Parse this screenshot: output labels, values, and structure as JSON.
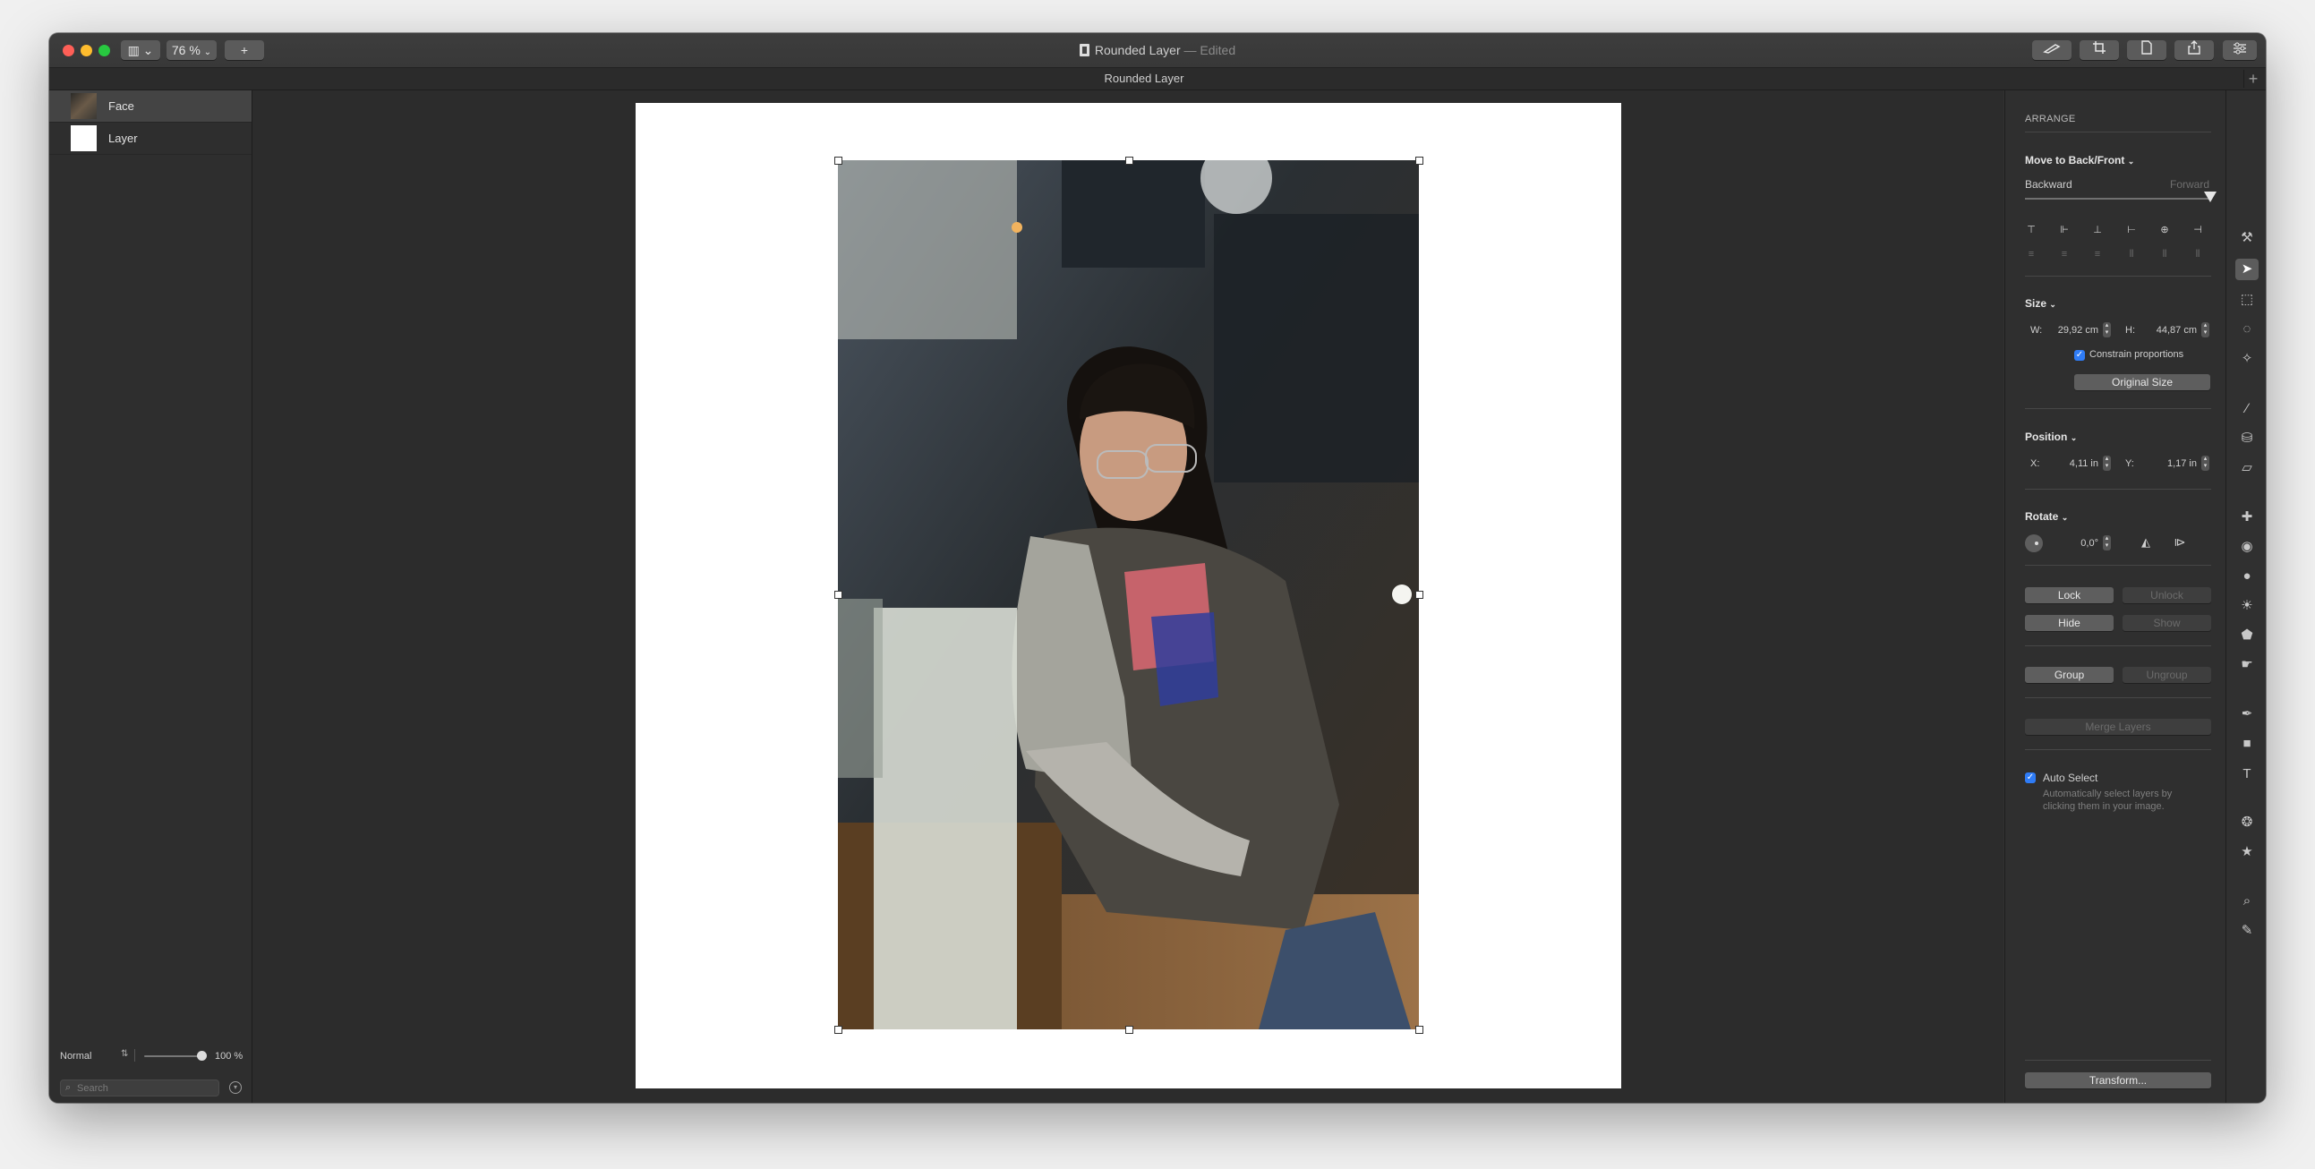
{
  "window": {
    "title": "Rounded Layer",
    "edited": "— Edited",
    "zoom": "76 %",
    "tab_title": "Rounded Layer",
    "add_tab": "+"
  },
  "toolbar": {
    "sidebar_btn": "▥ ⌄",
    "add_btn": "+"
  },
  "layers": [
    {
      "name": "Face",
      "thumb": "photo-thumb"
    },
    {
      "name": "Layer",
      "thumb": "white-thumb"
    }
  ],
  "layers_bottom": {
    "blend_mode": "Normal",
    "opacity": "100 %",
    "opacity_fraction": 1.0,
    "search_placeholder": "Search"
  },
  "inspector": {
    "section": "ARRANGE",
    "move_title": "Move to Back/Front",
    "backward": "Backward",
    "forward": "Forward",
    "size_title": "Size",
    "w_label": "W:",
    "w_value": "29,92 cm",
    "h_label": "H:",
    "h_value": "44,87 cm",
    "constrain": "Constrain proportions",
    "original_size": "Original Size",
    "position_title": "Position",
    "x_label": "X:",
    "x_value": "4,11 in",
    "y_label": "Y:",
    "y_value": "1,17 in",
    "rotate_title": "Rotate",
    "rotate_value": "0,0°",
    "lock": "Lock",
    "unlock": "Unlock",
    "hide": "Hide",
    "show": "Show",
    "group": "Group",
    "ungroup": "Ungroup",
    "merge": "Merge Layers",
    "auto_select": "Auto Select",
    "auto_select_desc": "Automatically select layers by clicking them in your image.",
    "transform": "Transform..."
  },
  "colors": {
    "accent": "#2f7cf6",
    "close": "#fe5f57",
    "minimize": "#febc2e",
    "maximize": "#28c840"
  }
}
